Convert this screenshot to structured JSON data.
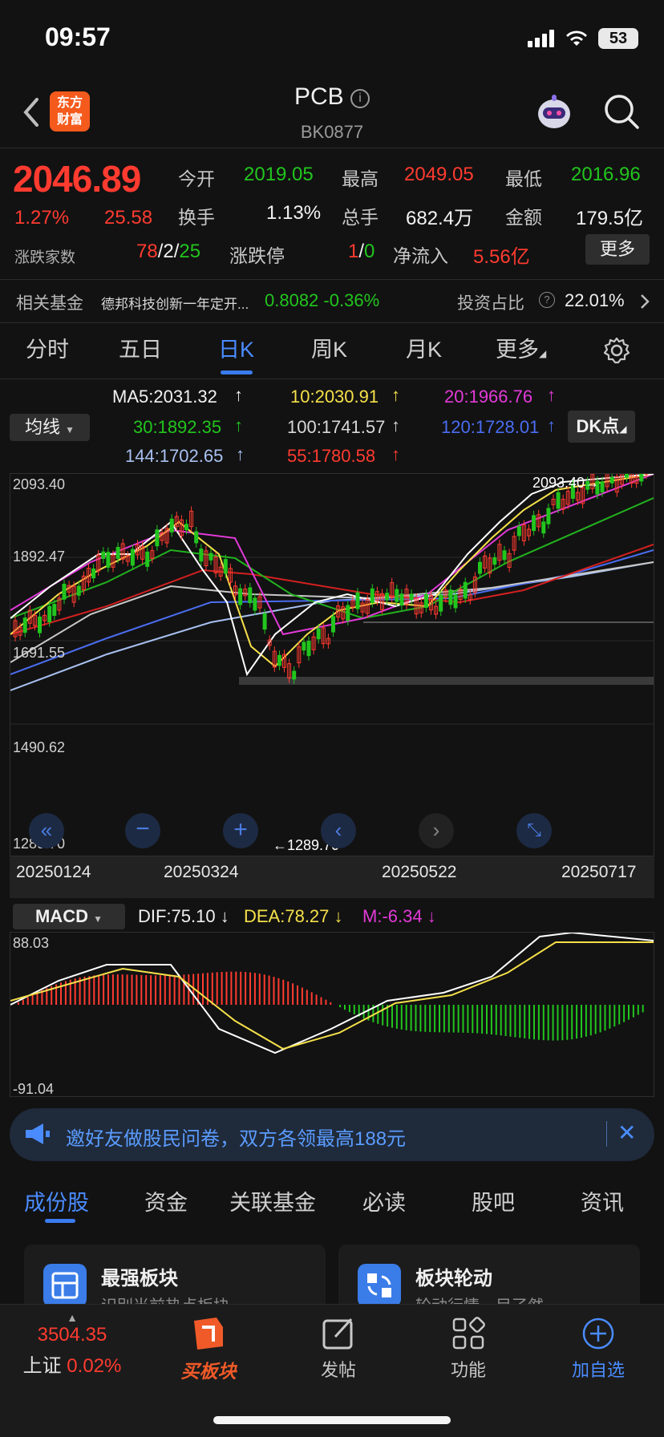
{
  "status_bar": {
    "time": "09:57",
    "battery": "53"
  },
  "header": {
    "title": "PCB",
    "code": "BK0877",
    "logo_line1": "东方",
    "logo_line2": "财富"
  },
  "quote": {
    "price": "2046.89",
    "change_pct": "1.27%",
    "change_val": "25.58",
    "open_label": "今开",
    "open_value": "2019.05",
    "high_label": "最高",
    "high_value": "2049.05",
    "low_label": "最低",
    "low_value": "2016.96",
    "turnover_label": "换手",
    "turnover_value": "1.13%",
    "volume_label": "总手",
    "volume_value": "682.4万",
    "amount_label": "金额",
    "amount_value": "179.5亿",
    "breadth_label": "涨跌家数",
    "breadth_up": "78",
    "breadth_flat": "2",
    "breadth_down": "25",
    "limit_label": "涨跌停",
    "limit_up": "1",
    "limit_down": "0",
    "inflow_label": "净流入",
    "inflow_value": "5.56亿",
    "more_label": "更多"
  },
  "fund": {
    "label": "相关基金",
    "name": "德邦科技创新一年定开...",
    "nav": "0.8082",
    "change": "-0.36%",
    "ratio_label": "投资占比",
    "ratio_value": "22.01%"
  },
  "kline_tabs": [
    {
      "label": "分时"
    },
    {
      "label": "五日"
    },
    {
      "label": "日K"
    },
    {
      "label": "周K"
    },
    {
      "label": "月K"
    },
    {
      "label": "更多"
    }
  ],
  "ma": {
    "selector": "均线",
    "dk_label": "DK点",
    "ma5": "MA5:2031.32",
    "ma10": "10:2030.91",
    "ma20": "20:1966.76",
    "ma30": "30:1892.35",
    "ma100": "100:1741.57",
    "ma120": "120:1728.01",
    "ma144": "144:1702.65",
    "ma55": "55:1780.58",
    "arrow": "↑"
  },
  "chart": {
    "y_labels": [
      "2093.40",
      "1892.47",
      "1691.55",
      "1490.62",
      "1289.70"
    ],
    "high_marker": "2093.40",
    "low_marker": "1289.70",
    "dates": [
      "20250124",
      "20250324",
      "20250522",
      "20250717"
    ]
  },
  "macd": {
    "selector": "MACD",
    "dif": "DIF:75.10",
    "dea": "DEA:78.27",
    "m": "M:-6.34",
    "down_arrow": "↓",
    "y_top": "88.03",
    "y_bottom": "-91.04"
  },
  "chart_data": {
    "type": "line",
    "title": "",
    "x_range": [
      "20250124",
      "20250717"
    ],
    "ylim": [
      1289.7,
      2093.4
    ],
    "series": [
      {
        "name": "MA5",
        "last": 2031.32
      },
      {
        "name": "10",
        "last": 2030.91
      },
      {
        "name": "20",
        "last": 1966.76
      },
      {
        "name": "30",
        "last": 1892.35
      },
      {
        "name": "55",
        "last": 1780.58
      },
      {
        "name": "100",
        "last": 1741.57
      },
      {
        "name": "120",
        "last": 1728.01
      },
      {
        "name": "144",
        "last": 1702.65
      }
    ],
    "grid": true,
    "colors": {
      "up": "#ff3b30",
      "down": "#22c51e",
      "ma5": "#ffffff",
      "ma10": "#f5e04a",
      "ma20": "#e23ad8",
      "ma30": "#22b21e",
      "ma55": "#d42020",
      "ma100": "#c8c8c8",
      "ma120": "#4a6df0",
      "ma144": "#a8c0f0"
    }
  },
  "banner": {
    "text": "邀好友做股民问卷，双方各领最高188元"
  },
  "section_tabs": [
    {
      "label": "成份股"
    },
    {
      "label": "资金"
    },
    {
      "label": "关联基金"
    },
    {
      "label": "必读"
    },
    {
      "label": "股吧"
    },
    {
      "label": "资讯"
    }
  ],
  "cards": [
    {
      "title": "最强板块",
      "sub": "识别当前热点板块"
    },
    {
      "title": "板块轮动",
      "sub": "轮动行情一目了然"
    }
  ],
  "bottom": {
    "index_value": "3504.35",
    "index_name": "上证",
    "index_change": "0.02%",
    "buy_label": "买板块",
    "post_label": "发帖",
    "func_label": "功能",
    "add_label": "加自选"
  }
}
